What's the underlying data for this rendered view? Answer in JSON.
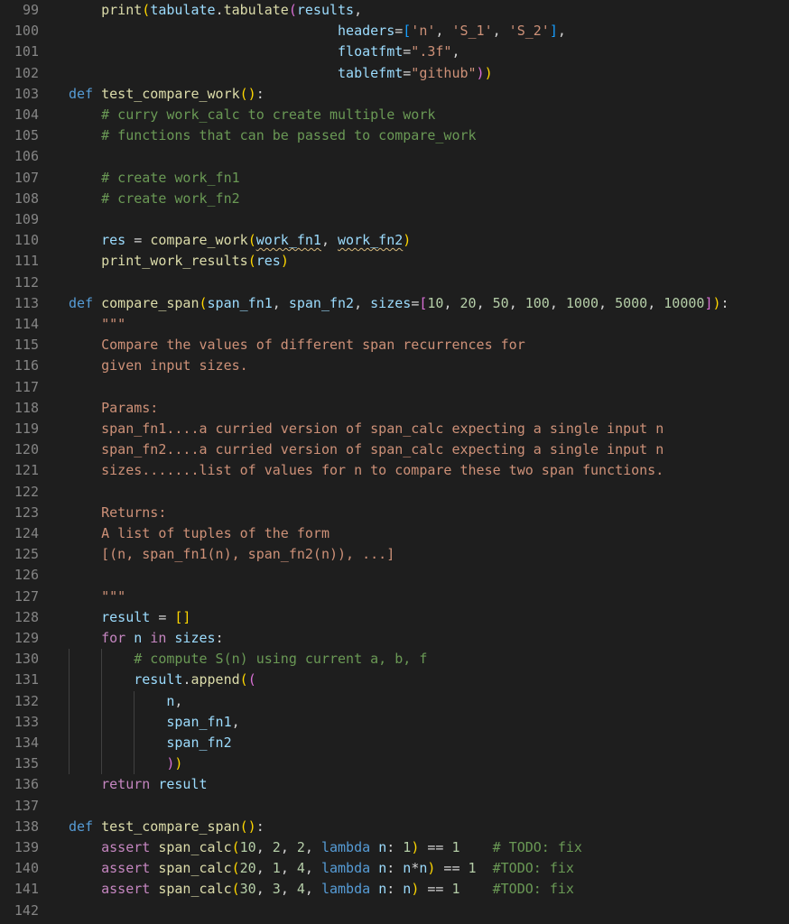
{
  "editor": {
    "language": "python",
    "theme": {
      "background": "#1e1e1e",
      "keyword": "#569cd6",
      "function": "#dcdcaa",
      "variable": "#9cdcfe",
      "string": "#ce9178",
      "number": "#b5cea8",
      "comment": "#6a9955",
      "line_number": "#858585"
    },
    "lines": [
      {
        "n": "99",
        "indent": 1,
        "t": [
          [
            "fn",
            "print"
          ],
          [
            "b1",
            "("
          ],
          [
            "var",
            "tabulate"
          ],
          [
            "p",
            "."
          ],
          [
            "fn",
            "tabulate"
          ],
          [
            "b2",
            "("
          ],
          [
            "var",
            "results"
          ],
          [
            "p",
            ","
          ]
        ]
      },
      {
        "n": "100",
        "indent": 0,
        "t": [
          [
            "p",
            "                                 "
          ],
          [
            "var",
            "headers"
          ],
          [
            "p",
            "="
          ],
          [
            "b3",
            "["
          ],
          [
            "str",
            "'n'"
          ],
          [
            "p",
            ", "
          ],
          [
            "str",
            "'S_1'"
          ],
          [
            "p",
            ", "
          ],
          [
            "str",
            "'S_2'"
          ],
          [
            "b3",
            "]"
          ],
          [
            "p",
            ","
          ]
        ]
      },
      {
        "n": "101",
        "indent": 0,
        "t": [
          [
            "p",
            "                                 "
          ],
          [
            "var",
            "floatfmt"
          ],
          [
            "p",
            "="
          ],
          [
            "str",
            "\".3f\""
          ],
          [
            "p",
            ","
          ]
        ]
      },
      {
        "n": "102",
        "indent": 0,
        "t": [
          [
            "p",
            "                                 "
          ],
          [
            "var",
            "tablefmt"
          ],
          [
            "p",
            "="
          ],
          [
            "str",
            "\"github\""
          ],
          [
            "b2",
            ")"
          ],
          [
            "b1",
            ")"
          ]
        ]
      },
      {
        "n": "103",
        "indent": 0,
        "t": [
          [
            "kw",
            "def "
          ],
          [
            "fn",
            "test_compare_work"
          ],
          [
            "b1",
            "()"
          ],
          [
            "p",
            ":"
          ]
        ]
      },
      {
        "n": "104",
        "indent": 1,
        "t": [
          [
            "com",
            "# curry work_calc to create multiple work"
          ]
        ]
      },
      {
        "n": "105",
        "indent": 1,
        "t": [
          [
            "com",
            "# functions that can be passed to compare_work"
          ]
        ]
      },
      {
        "n": "106",
        "indent": 0,
        "t": []
      },
      {
        "n": "107",
        "indent": 1,
        "t": [
          [
            "com",
            "# create work_fn1"
          ]
        ]
      },
      {
        "n": "108",
        "indent": 1,
        "t": [
          [
            "com",
            "# create work_fn2"
          ]
        ]
      },
      {
        "n": "109",
        "indent": 0,
        "t": []
      },
      {
        "n": "110",
        "indent": 1,
        "t": [
          [
            "var",
            "res"
          ],
          [
            "p",
            " = "
          ],
          [
            "fn",
            "compare_work"
          ],
          [
            "b1",
            "("
          ],
          [
            "sq",
            "work_fn1"
          ],
          [
            "p",
            ", "
          ],
          [
            "sq",
            "work_fn2"
          ],
          [
            "b1",
            ")"
          ]
        ]
      },
      {
        "n": "111",
        "indent": 1,
        "t": [
          [
            "fn",
            "print_work_results"
          ],
          [
            "b1",
            "("
          ],
          [
            "var",
            "res"
          ],
          [
            "b1",
            ")"
          ]
        ]
      },
      {
        "n": "112",
        "indent": 0,
        "t": []
      },
      {
        "n": "113",
        "indent": 0,
        "t": [
          [
            "kw",
            "def "
          ],
          [
            "fn",
            "compare_span"
          ],
          [
            "b1",
            "("
          ],
          [
            "var",
            "span_fn1"
          ],
          [
            "p",
            ", "
          ],
          [
            "var",
            "span_fn2"
          ],
          [
            "p",
            ", "
          ],
          [
            "var",
            "sizes"
          ],
          [
            "p",
            "="
          ],
          [
            "b2",
            "["
          ],
          [
            "num",
            "10"
          ],
          [
            "p",
            ", "
          ],
          [
            "num",
            "20"
          ],
          [
            "p",
            ", "
          ],
          [
            "num",
            "50"
          ],
          [
            "p",
            ", "
          ],
          [
            "num",
            "100"
          ],
          [
            "p",
            ", "
          ],
          [
            "num",
            "1000"
          ],
          [
            "p",
            ", "
          ],
          [
            "num",
            "5000"
          ],
          [
            "p",
            ", "
          ],
          [
            "num",
            "10000"
          ],
          [
            "b2",
            "]"
          ],
          [
            "b1",
            ")"
          ],
          [
            "p",
            ":"
          ]
        ]
      },
      {
        "n": "114",
        "indent": 1,
        "t": [
          [
            "str",
            "\"\"\""
          ]
        ]
      },
      {
        "n": "115",
        "indent": 1,
        "t": [
          [
            "str",
            "Compare the values of different span recurrences for"
          ]
        ]
      },
      {
        "n": "116",
        "indent": 1,
        "t": [
          [
            "str",
            "given input sizes."
          ]
        ]
      },
      {
        "n": "117",
        "indent": 0,
        "t": []
      },
      {
        "n": "118",
        "indent": 1,
        "t": [
          [
            "str",
            "Params:"
          ]
        ]
      },
      {
        "n": "119",
        "indent": 1,
        "t": [
          [
            "str",
            "span_fn1....a curried version of span_calc expecting a single input n"
          ]
        ]
      },
      {
        "n": "120",
        "indent": 1,
        "t": [
          [
            "str",
            "span_fn2....a curried version of span_calc expecting a single input n"
          ]
        ]
      },
      {
        "n": "121",
        "indent": 1,
        "t": [
          [
            "str",
            "sizes.......list of values for n to compare these two span functions."
          ]
        ]
      },
      {
        "n": "122",
        "indent": 0,
        "t": []
      },
      {
        "n": "123",
        "indent": 1,
        "t": [
          [
            "str",
            "Returns:"
          ]
        ]
      },
      {
        "n": "124",
        "indent": 1,
        "t": [
          [
            "str",
            "A list of tuples of the form"
          ]
        ]
      },
      {
        "n": "125",
        "indent": 1,
        "t": [
          [
            "str",
            "[(n, span_fn1(n), span_fn2(n)), ...]"
          ]
        ]
      },
      {
        "n": "126",
        "indent": 0,
        "t": []
      },
      {
        "n": "127",
        "indent": 1,
        "t": [
          [
            "str",
            "\"\"\""
          ]
        ]
      },
      {
        "n": "128",
        "indent": 1,
        "t": [
          [
            "var",
            "result"
          ],
          [
            "p",
            " = "
          ],
          [
            "b1",
            "[]"
          ]
        ]
      },
      {
        "n": "129",
        "indent": 1,
        "t": [
          [
            "ctl",
            "for "
          ],
          [
            "var",
            "n"
          ],
          [
            "ctl",
            " in "
          ],
          [
            "var",
            "sizes"
          ],
          [
            "p",
            ":"
          ]
        ]
      },
      {
        "n": "130",
        "indent": 2,
        "t": [
          [
            "com",
            "# compute S(n) using current a, b, f"
          ]
        ]
      },
      {
        "n": "131",
        "indent": 2,
        "t": [
          [
            "var",
            "result"
          ],
          [
            "p",
            "."
          ],
          [
            "fn",
            "append"
          ],
          [
            "b1",
            "("
          ],
          [
            "b2",
            "("
          ]
        ]
      },
      {
        "n": "132",
        "indent": 3,
        "t": [
          [
            "var",
            "n"
          ],
          [
            "p",
            ","
          ]
        ]
      },
      {
        "n": "133",
        "indent": 3,
        "t": [
          [
            "var",
            "span_fn1"
          ],
          [
            "p",
            ","
          ]
        ]
      },
      {
        "n": "134",
        "indent": 3,
        "t": [
          [
            "var",
            "span_fn2"
          ]
        ]
      },
      {
        "n": "135",
        "indent": 3,
        "t": [
          [
            "b2",
            ")"
          ],
          [
            "b1",
            ")"
          ]
        ]
      },
      {
        "n": "136",
        "indent": 1,
        "t": [
          [
            "ctl",
            "return "
          ],
          [
            "var",
            "result"
          ]
        ]
      },
      {
        "n": "137",
        "indent": 0,
        "t": []
      },
      {
        "n": "138",
        "indent": 0,
        "t": [
          [
            "kw",
            "def "
          ],
          [
            "fn",
            "test_compare_span"
          ],
          [
            "b1",
            "()"
          ],
          [
            "p",
            ":"
          ]
        ]
      },
      {
        "n": "139",
        "indent": 1,
        "t": [
          [
            "ctl",
            "assert "
          ],
          [
            "fn",
            "span_calc"
          ],
          [
            "b1",
            "("
          ],
          [
            "num",
            "10"
          ],
          [
            "p",
            ", "
          ],
          [
            "num",
            "2"
          ],
          [
            "p",
            ", "
          ],
          [
            "num",
            "2"
          ],
          [
            "p",
            ", "
          ],
          [
            "kw",
            "lambda "
          ],
          [
            "var",
            "n"
          ],
          [
            "p",
            ": "
          ],
          [
            "num",
            "1"
          ],
          [
            "b1",
            ")"
          ],
          [
            "p",
            " == "
          ],
          [
            "num",
            "1"
          ],
          [
            "p",
            "    "
          ],
          [
            "com",
            "# TODO: fix"
          ]
        ]
      },
      {
        "n": "140",
        "indent": 1,
        "t": [
          [
            "ctl",
            "assert "
          ],
          [
            "fn",
            "span_calc"
          ],
          [
            "b1",
            "("
          ],
          [
            "num",
            "20"
          ],
          [
            "p",
            ", "
          ],
          [
            "num",
            "1"
          ],
          [
            "p",
            ", "
          ],
          [
            "num",
            "4"
          ],
          [
            "p",
            ", "
          ],
          [
            "kw",
            "lambda "
          ],
          [
            "var",
            "n"
          ],
          [
            "p",
            ": "
          ],
          [
            "var",
            "n"
          ],
          [
            "p",
            "*"
          ],
          [
            "var",
            "n"
          ],
          [
            "b1",
            ")"
          ],
          [
            "p",
            " == "
          ],
          [
            "num",
            "1"
          ],
          [
            "p",
            "  "
          ],
          [
            "com",
            "#TODO: fix"
          ]
        ]
      },
      {
        "n": "141",
        "indent": 1,
        "t": [
          [
            "ctl",
            "assert "
          ],
          [
            "fn",
            "span_calc"
          ],
          [
            "b1",
            "("
          ],
          [
            "num",
            "30"
          ],
          [
            "p",
            ", "
          ],
          [
            "num",
            "3"
          ],
          [
            "p",
            ", "
          ],
          [
            "num",
            "4"
          ],
          [
            "p",
            ", "
          ],
          [
            "kw",
            "lambda "
          ],
          [
            "var",
            "n"
          ],
          [
            "p",
            ": "
          ],
          [
            "var",
            "n"
          ],
          [
            "b1",
            ")"
          ],
          [
            "p",
            " == "
          ],
          [
            "num",
            "1"
          ],
          [
            "p",
            "    "
          ],
          [
            "com",
            "#TODO: fix"
          ]
        ]
      },
      {
        "n": "142",
        "indent": 0,
        "t": []
      }
    ]
  }
}
